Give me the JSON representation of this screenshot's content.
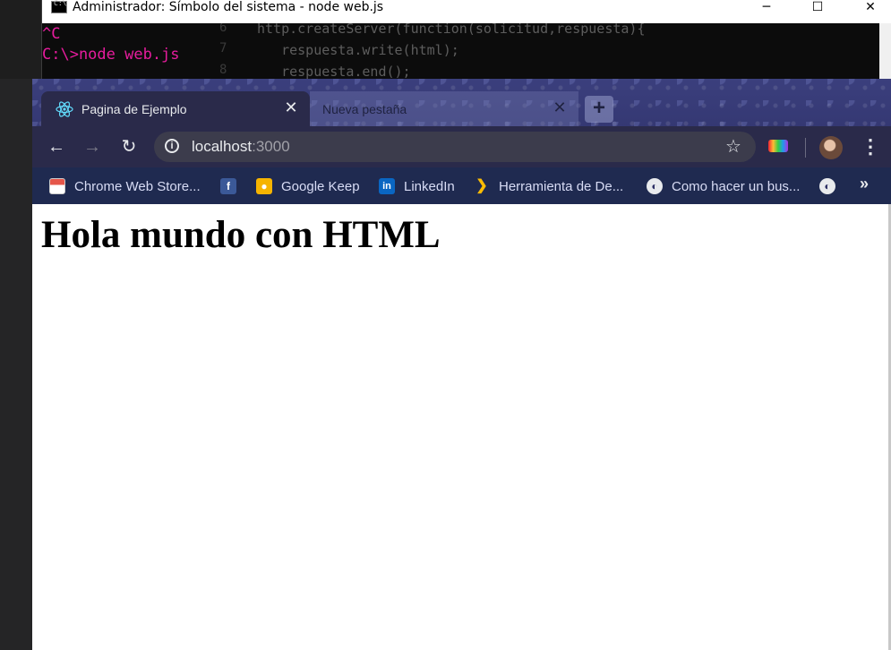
{
  "cmd_window": {
    "title": "Administrador: Símbolo del sistema - node  web.js",
    "lines": [
      "^C",
      "C:\\>node web.js"
    ],
    "controls": {
      "minimize": "─",
      "maximize": "☐",
      "close": "✕"
    }
  },
  "editor_behind": {
    "line_numbers": [
      "6",
      "7",
      "8"
    ],
    "code": [
      "http.createServer(function(solicitud,respuesta){",
      "   respuesta.write(html);",
      "   respuesta.end();"
    ]
  },
  "browser": {
    "tabs": [
      {
        "label": "Pagina de Ejemplo",
        "active": true,
        "icon": "react-icon"
      },
      {
        "label": "Nueva pestaña",
        "active": false
      }
    ],
    "new_tab_symbol": "+",
    "address": {
      "host": "localhost",
      "port": ":3000"
    },
    "bookmarks": [
      {
        "label": "Chrome Web Store...",
        "icon": "chrome-web-store-icon",
        "color": "#e5564a"
      },
      {
        "label": "",
        "icon": "facebook-icon",
        "color": "#3b5998"
      },
      {
        "label": "Google Keep",
        "icon": "google-keep-icon",
        "color": "#f6b400"
      },
      {
        "label": "LinkedIn",
        "icon": "linkedin-icon",
        "color": "#0a66c2"
      },
      {
        "label": "Herramienta de De...",
        "icon": "devtools-icon",
        "color": "#4285f4"
      },
      {
        "label": "Como hacer un bus...",
        "icon": "globe-icon",
        "color": "#e8eaed"
      },
      {
        "label": "",
        "icon": "globe-icon",
        "color": "#e8eaed"
      }
    ],
    "bookmarks_more": "»"
  },
  "page": {
    "heading": "Hola mundo con HTML"
  }
}
